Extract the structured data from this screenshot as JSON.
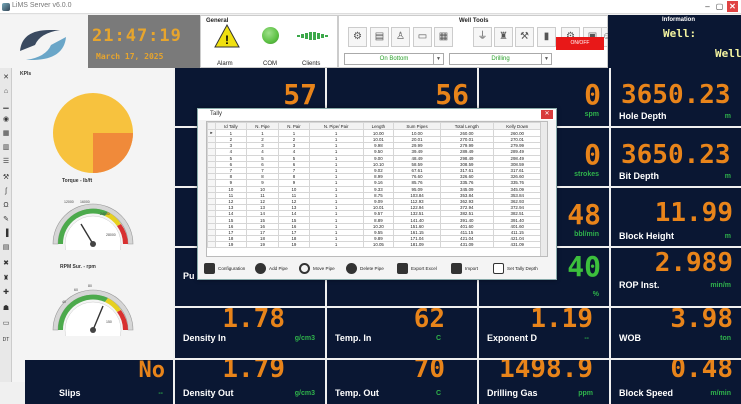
{
  "window": {
    "title": "LiMS Server v6.0.0"
  },
  "header": {
    "time": "21:47:19",
    "date": "March 17, 2025",
    "general_title": "General",
    "alarm_label": "Alarm",
    "com_label": "COM",
    "clients_label": "Clients",
    "welltools_title": "Well Tools",
    "select_left": "On Bottom",
    "select_right": "Drilling",
    "stop_label": "ON/OFF",
    "info_title": "Information",
    "well_label": "Well:",
    "well_scroll": "Well"
  },
  "left_panel": {
    "pie_title": "KPIs",
    "torque_title": "Torque - lb/ft",
    "rpm_title": "RPM Sur. - rpm",
    "torque_ticks": [
      "0",
      "4000",
      "8000",
      "12000",
      "16000",
      "20000",
      "24000",
      "28000"
    ],
    "rpm_ticks": [
      "0",
      "40",
      "60",
      "80",
      "100",
      "120",
      "150"
    ],
    "pie": {
      "filled_fraction": 0.25
    }
  },
  "colors": {
    "tile_bg": "#0a1733",
    "value": "#e8841a",
    "unit": "#2fb24b",
    "alarm": "#f0e010",
    "com": "#5cc043"
  },
  "tiles": {
    "r1c1": {
      "value": "57"
    },
    "r1c2": {
      "value": "56"
    },
    "r1c3": {
      "value": "0",
      "unit": "spm"
    },
    "hole_depth": {
      "label": "Hole Depth",
      "value": "3650.23",
      "unit": "m"
    },
    "r2c3": {
      "value": "0",
      "unit": "strokes"
    },
    "bit_depth": {
      "label": "Bit Depth",
      "value": "3650.23",
      "unit": "m"
    },
    "r3c3": {
      "value": "48",
      "unit": "bbl/min"
    },
    "block_height": {
      "label": "Block Height",
      "value": "11.99",
      "unit": "m"
    },
    "r4c1": {
      "label": "Pu"
    },
    "r4c3": {
      "value": "40",
      "unit": "%"
    },
    "rop": {
      "label": "ROP Inst.",
      "value": "2.989",
      "unit": "min/m"
    },
    "density_in": {
      "label": "Density In",
      "value": "1.78",
      "unit": "g/cm3"
    },
    "temp_in": {
      "label": "Temp. In",
      "value": "62",
      "unit": "C"
    },
    "exponent_d": {
      "label": "Exponent D",
      "value": "1.19",
      "unit": "--"
    },
    "wob": {
      "label": "WOB",
      "value": "3.98",
      "unit": "ton"
    },
    "slips": {
      "label": "Slips",
      "value": "No",
      "unit": "--"
    },
    "density_out": {
      "label": "Density Out",
      "value": "1.79",
      "unit": "g/cm3"
    },
    "temp_out": {
      "label": "Temp. Out",
      "value": "70",
      "unit": "C"
    },
    "drilling_gas": {
      "label": "Drilling Gas",
      "value": "1498.9",
      "unit": "ppm"
    },
    "block_speed": {
      "label": "Block Speed",
      "value": "0.48",
      "unit": "m/min"
    }
  },
  "dialog": {
    "title": "Tally",
    "close": "✕",
    "columns": [
      "Id Tally",
      "N. Pipe",
      "N. Pair",
      "N. Pipe/ Pair",
      "Length",
      "Sum Pipes",
      "Total Length",
      "Kelly Down"
    ],
    "rows": [
      [
        "1",
        "1",
        "1",
        "1",
        "10.00",
        "10.00",
        "260.00",
        "260.00"
      ],
      [
        "2",
        "2",
        "2",
        "1",
        "10.01",
        "20.01",
        "270.01",
        "270.01"
      ],
      [
        "3",
        "3",
        "3",
        "1",
        "9.98",
        "29.99",
        "279.99",
        "279.99"
      ],
      [
        "4",
        "4",
        "4",
        "1",
        "9.50",
        "39.49",
        "289.49",
        "289.49"
      ],
      [
        "5",
        "5",
        "5",
        "1",
        "9.00",
        "48.49",
        "298.49",
        "298.49"
      ],
      [
        "6",
        "6",
        "6",
        "1",
        "10.10",
        "58.59",
        "308.59",
        "308.59"
      ],
      [
        "7",
        "7",
        "7",
        "1",
        "9.02",
        "67.61",
        "317.61",
        "317.61"
      ],
      [
        "8",
        "8",
        "8",
        "1",
        "8.99",
        "76.60",
        "326.60",
        "326.60"
      ],
      [
        "9",
        "9",
        "9",
        "1",
        "9.16",
        "85.76",
        "335.76",
        "335.76"
      ],
      [
        "10",
        "10",
        "10",
        "1",
        "9.33",
        "95.09",
        "345.09",
        "345.09"
      ],
      [
        "11",
        "11",
        "11",
        "1",
        "8.75",
        "103.84",
        "353.84",
        "353.84"
      ],
      [
        "12",
        "12",
        "12",
        "1",
        "9.09",
        "112.93",
        "362.93",
        "362.93"
      ],
      [
        "13",
        "13",
        "13",
        "1",
        "10.01",
        "122.94",
        "372.94",
        "372.94"
      ],
      [
        "14",
        "14",
        "14",
        "1",
        "9.57",
        "132.51",
        "382.51",
        "382.51"
      ],
      [
        "15",
        "15",
        "15",
        "1",
        "8.89",
        "141.40",
        "391.40",
        "391.40"
      ],
      [
        "16",
        "16",
        "16",
        "1",
        "10.20",
        "151.60",
        "401.60",
        "401.60"
      ],
      [
        "17",
        "17",
        "17",
        "1",
        "9.55",
        "161.15",
        "411.15",
        "411.15"
      ],
      [
        "18",
        "18",
        "18",
        "1",
        "9.89",
        "171.04",
        "421.04",
        "421.04"
      ],
      [
        "19",
        "19",
        "19",
        "1",
        "10.05",
        "181.09",
        "431.09",
        "431.09"
      ]
    ],
    "buttons": [
      "Configuration",
      "Add Pipe",
      "Move Pipe",
      "Delete Pipe",
      "Export Excel",
      "Import",
      "Set Tally Depth"
    ]
  }
}
